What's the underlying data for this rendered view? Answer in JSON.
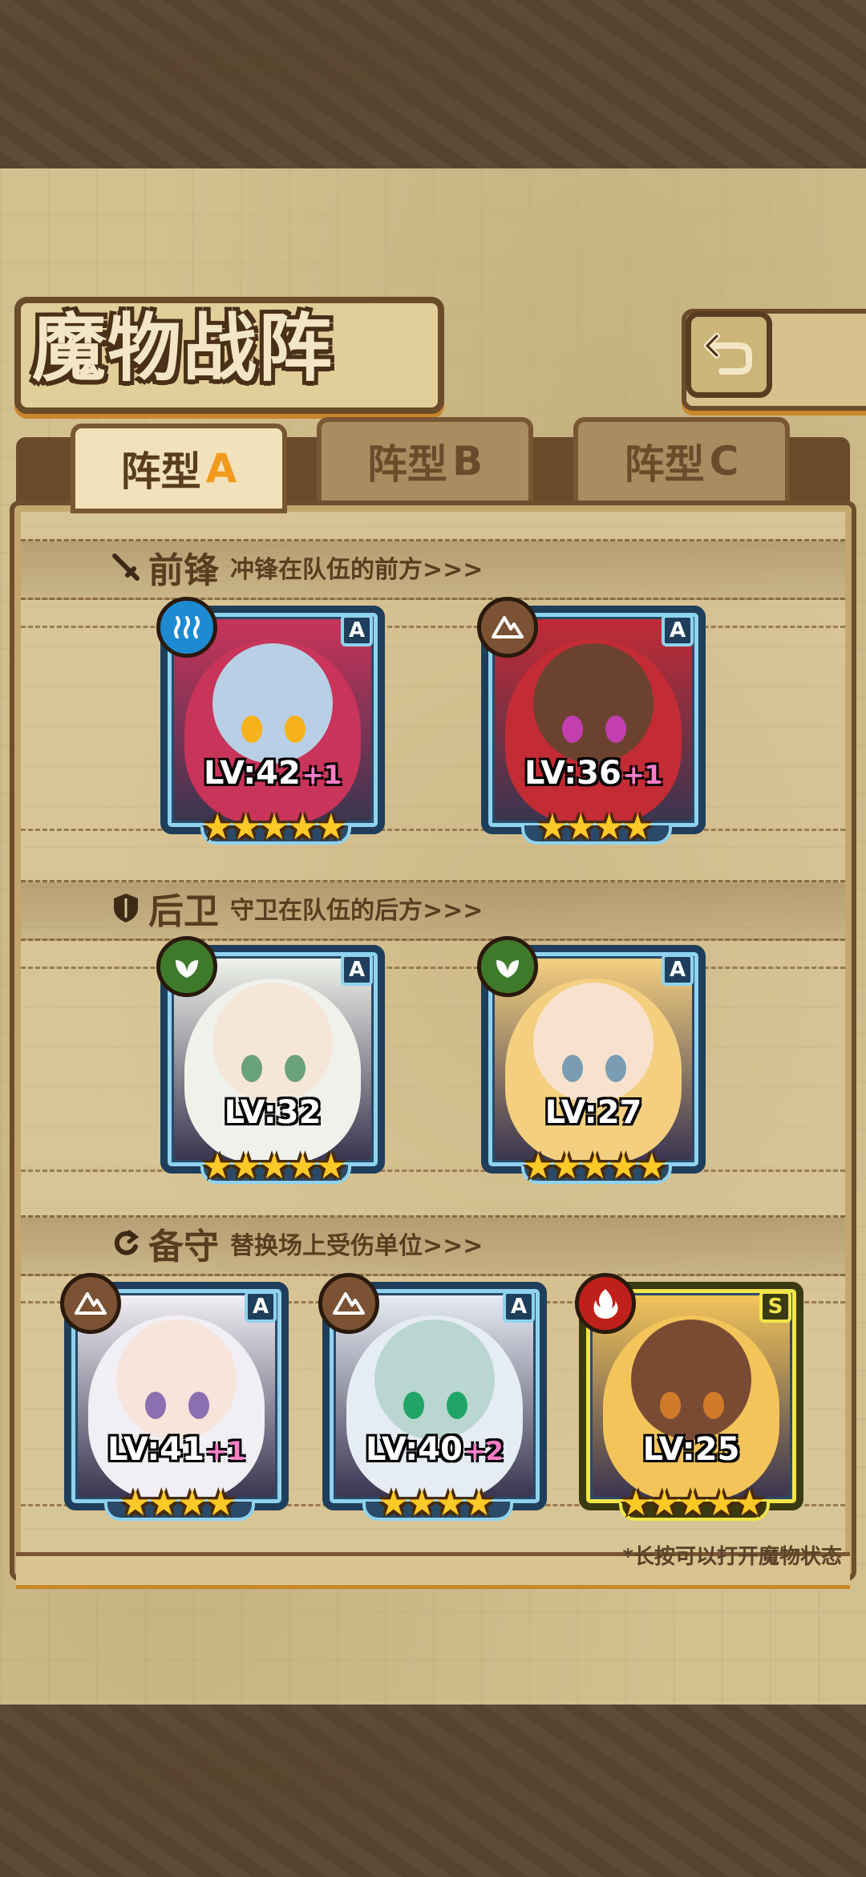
{
  "title": "魔物战阵",
  "tabs": [
    {
      "prefix": "阵型",
      "letter": "A",
      "active": true
    },
    {
      "prefix": "阵型",
      "letter": "B",
      "active": false
    },
    {
      "prefix": "阵型",
      "letter": "C",
      "active": false
    }
  ],
  "sections": {
    "vanguard": {
      "title": "前锋",
      "desc": "冲锋在队伍的前方>>>",
      "icon": "sword-icon"
    },
    "rear": {
      "title": "后卫",
      "desc": "守卫在队伍的后方>>>",
      "icon": "shield-icon"
    },
    "reserve": {
      "title": "备守",
      "desc": "替换场上受伤单位>>>",
      "icon": "swap-icon"
    }
  },
  "monsters": [
    {
      "level": "LV:42",
      "plus": "+1",
      "rank": "A",
      "element": "water",
      "stars": "★★★★★",
      "hair": "#c8345a",
      "skin": "#b9cfe6",
      "eye": "#f6b21b"
    },
    {
      "level": "LV:36",
      "plus": "+1",
      "rank": "A",
      "element": "earth",
      "stars": "★★★★",
      "hair": "#c32b35",
      "skin": "#6b4230",
      "eye": "#c33fb0"
    },
    {
      "level": "LV:32",
      "plus": "",
      "rank": "A",
      "element": "wood",
      "stars": "★★★★★",
      "hair": "#eef2ea",
      "skin": "#f6e6d8",
      "eye": "#6aa27a"
    },
    {
      "level": "LV:27",
      "plus": "",
      "rank": "A",
      "element": "wood",
      "stars": "★★★★★",
      "hair": "#f4cf7f",
      "skin": "#f8e2cf",
      "eye": "#7a9db3"
    },
    {
      "level": "LV:41",
      "plus": "+1",
      "rank": "A",
      "element": "earth",
      "stars": "★★★★",
      "hair": "#f1eef4",
      "skin": "#f7e4da",
      "eye": "#8b6fb0"
    },
    {
      "level": "LV:40",
      "plus": "+2",
      "rank": "A",
      "element": "earth",
      "stars": "★★★★",
      "hair": "#e6ecf3",
      "skin": "#b9d7d0",
      "eye": "#21a566"
    },
    {
      "level": "LV:25",
      "plus": "",
      "rank": "S",
      "element": "fire",
      "stars": "★★★★★",
      "hair": "#f2c45a",
      "skin": "#7a4b33",
      "eye": "#d07a2a"
    }
  ],
  "note": "*长按可以打开魔物状态"
}
